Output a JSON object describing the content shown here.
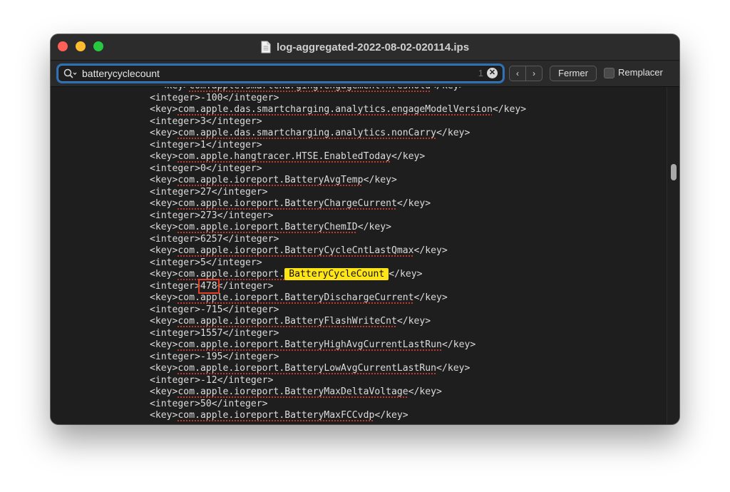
{
  "window": {
    "title": "log-aggregated-2022-08-02-020114.ips",
    "doc_icon": "document-icon",
    "traffic_lights": {
      "close": "#fe5f57",
      "minimize": "#febc2e",
      "zoom": "#28c840"
    }
  },
  "findbar": {
    "search_value": "batterycyclecount",
    "match_count": "1",
    "close_label": "Fermer",
    "replace_label": "Remplacer",
    "replace_checked": false,
    "prev_icon": "‹",
    "next_icon": "›"
  },
  "content": {
    "lines": [
      {
        "pre": "  <key>",
        "key": "com.apple.smartcharging.engagementThreshold",
        "post": "</key>"
      },
      {
        "pre": "<integer>",
        "val": "-100",
        "post": "</integer>"
      },
      {
        "pre": "<key>",
        "key": "com.apple.das.smartcharging.analytics.engageModelVersion",
        "post": "</key>"
      },
      {
        "pre": "<integer>",
        "val": "3",
        "post": "</integer>"
      },
      {
        "pre": "<key>",
        "key": "com.apple.das.smartcharging.analytics.nonCarry",
        "post": "</key>"
      },
      {
        "pre": "<integer>",
        "val": "1",
        "post": "</integer>"
      },
      {
        "pre": "<key>",
        "key": "com.apple.hangtracer.HTSE.EnabledToday",
        "post": "</key>"
      },
      {
        "pre": "<integer>",
        "val": "0",
        "post": "</integer>"
      },
      {
        "pre": "<key>",
        "key": "com.apple.ioreport.BatteryAvgTemp",
        "post": "</key>"
      },
      {
        "pre": "<integer>",
        "val": "27",
        "post": "</integer>"
      },
      {
        "pre": "<key>",
        "key": "com.apple.ioreport.BatteryChargeCurrent",
        "post": "</key>"
      },
      {
        "pre": "<integer>",
        "val": "273",
        "post": "</integer>"
      },
      {
        "pre": "<key>",
        "key": "com.apple.ioreport.BatteryChemID",
        "post": "</key>"
      },
      {
        "pre": "<integer>",
        "val": "6257",
        "post": "</integer>"
      },
      {
        "pre": "<key>",
        "key": "com.apple.ioreport.BatteryCycleCntLastQmax",
        "post": "</key>"
      },
      {
        "pre": "<integer>",
        "val": "5",
        "post": "</integer>"
      },
      {
        "pre": "<key>",
        "key_prefix": "com.apple.ioreport.",
        "key_match": "BatteryCycleCount",
        "post": "</key>"
      },
      {
        "pre": "<integer>",
        "val": "478",
        "post": "</integer>",
        "boxed": true
      },
      {
        "pre": "<key>",
        "key": "com.apple.ioreport.BatteryDischargeCurrent",
        "post": "</key>"
      },
      {
        "pre": "<integer>",
        "val": "-715",
        "post": "</integer>"
      },
      {
        "pre": "<key>",
        "key": "com.apple.ioreport.BatteryFlashWriteCnt",
        "post": "</key>"
      },
      {
        "pre": "<integer>",
        "val": "1557",
        "post": "</integer>"
      },
      {
        "pre": "<key>",
        "key": "com.apple.ioreport.BatteryHighAvgCurrentLastRun",
        "post": "</key>"
      },
      {
        "pre": "<integer>",
        "val": "-195",
        "post": "</integer>"
      },
      {
        "pre": "<key>",
        "key": "com.apple.ioreport.BatteryLowAvgCurrentLastRun",
        "post": "</key>"
      },
      {
        "pre": "<integer>",
        "val": "-12",
        "post": "</integer>"
      },
      {
        "pre": "<key>",
        "key": "com.apple.ioreport.BatteryMaxDeltaVoltage",
        "post": "</key>"
      },
      {
        "pre": "<integer>",
        "val": "50",
        "post": "</integer>"
      },
      {
        "pre": "<key>",
        "key": "com.apple.ioreport.BatteryMaxFCCvdp",
        "post": "</key>"
      }
    ]
  },
  "colors": {
    "search_highlight": "#ffe516",
    "annotation_box": "#e13f2a",
    "spellcheck_underline": "#c0392b"
  }
}
